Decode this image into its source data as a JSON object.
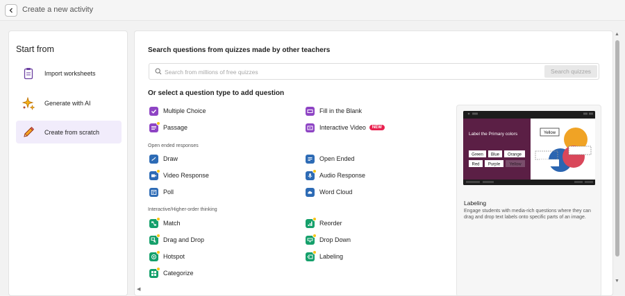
{
  "header": {
    "back_icon": "chevron-left-icon",
    "title": "Create a new activity"
  },
  "sidebar": {
    "title": "Start from",
    "items": [
      {
        "label": "Import worksheets",
        "icon": "clipboard-icon",
        "active": false
      },
      {
        "label": "Generate with AI",
        "icon": "sparkle-icon",
        "active": false
      },
      {
        "label": "Create from scratch",
        "icon": "pencil-icon",
        "active": true
      }
    ]
  },
  "search": {
    "heading": "Search questions from quizzes made by other teachers",
    "placeholder": "Search from millions of free quizzes",
    "button": "Search quizzes"
  },
  "question_types": {
    "heading": "Or select a question type to add question",
    "basic": [
      {
        "label": "Multiple Choice",
        "color": "#8e44c4",
        "icon": "checkbox-icon"
      },
      {
        "label": "Fill in the Blank",
        "color": "#8e44c4",
        "icon": "blank-box-icon"
      },
      {
        "label": "Passage",
        "color": "#8e44c4",
        "icon": "lines-icon",
        "premium": true
      },
      {
        "label": "Interactive Video",
        "color": "#8e44c4",
        "icon": "video-icon",
        "badge": "NEW"
      }
    ],
    "open_ended_label": "Open ended responses",
    "open_ended": [
      {
        "label": "Draw",
        "color": "#2d6bb5",
        "icon": "brush-icon"
      },
      {
        "label": "Open Ended",
        "color": "#2d6bb5",
        "icon": "text-icon"
      },
      {
        "label": "Video Response",
        "color": "#2d6bb5",
        "icon": "camera-icon",
        "premium": true
      },
      {
        "label": "Audio Response",
        "color": "#2d6bb5",
        "icon": "mic-icon",
        "premium": true
      },
      {
        "label": "Poll",
        "color": "#2d6bb5",
        "icon": "poll-icon"
      },
      {
        "label": "Word Cloud",
        "color": "#2d6bb5",
        "icon": "cloud-icon"
      }
    ],
    "interactive_label": "Interactive/Higher-order thinking",
    "interactive": [
      {
        "label": "Match",
        "color": "#15a06b",
        "icon": "match-icon",
        "premium": true
      },
      {
        "label": "Reorder",
        "color": "#15a06b",
        "icon": "reorder-icon",
        "premium": true
      },
      {
        "label": "Drag and Drop",
        "color": "#15a06b",
        "icon": "drag-icon",
        "premium": true
      },
      {
        "label": "Drop Down",
        "color": "#15a06b",
        "icon": "dropdown-icon",
        "premium": true
      },
      {
        "label": "Hotspot",
        "color": "#15a06b",
        "icon": "hotspot-icon",
        "premium": true
      },
      {
        "label": "Labeling",
        "color": "#15a06b",
        "icon": "label-icon",
        "premium": true
      },
      {
        "label": "Categorize",
        "color": "#15a06b",
        "icon": "categorize-icon",
        "premium": true
      }
    ]
  },
  "preview": {
    "title": "Labeling",
    "description": "Engage students with media-rich questions where they can drag and drop text labels onto specific parts of an image.",
    "image": {
      "heading": "Label the Primary colors",
      "tags": [
        "Green",
        "Blue",
        "Orange",
        "Red",
        "Purple",
        "Yellow"
      ],
      "placed_label": "Yellow"
    }
  }
}
